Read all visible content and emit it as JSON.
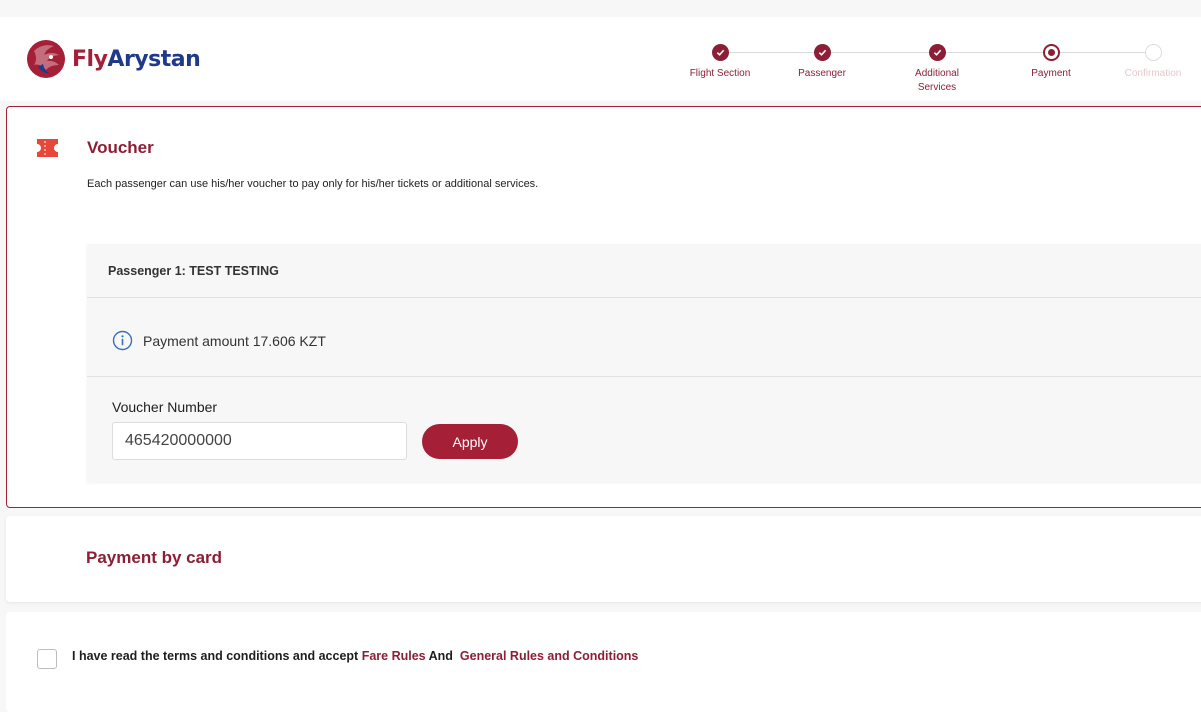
{
  "brand": {
    "name_part1": "Fly",
    "name_part2": "Arystan",
    "colors": {
      "primary": "#a51f37",
      "dark": "#8c1f35",
      "blue": "#1f3a8a"
    }
  },
  "stepper": {
    "steps": [
      {
        "label": "Flight Section",
        "state": "done"
      },
      {
        "label": "Passenger",
        "state": "done"
      },
      {
        "label": "Additional Services",
        "state": "done"
      },
      {
        "label": "Payment",
        "state": "current"
      },
      {
        "label": "Confirmation",
        "state": "todo"
      }
    ]
  },
  "voucher": {
    "icon": "ticket-icon",
    "title": "Voucher",
    "description": "Each passenger can use his/her voucher to pay only for his/her tickets or additional services.",
    "passenger": {
      "name": "Passenger 1: TEST TESTING",
      "payment_icon": "info-icon",
      "payment_amount": "Payment amount 17.606 KZT",
      "voucher_number_label": "Voucher Number",
      "voucher_number_value": "465420000000",
      "apply_label": "Apply"
    }
  },
  "card_payment": {
    "title": "Payment by card"
  },
  "terms": {
    "text": "I have read the terms and conditions and accept",
    "fare_rules_link": "Fare Rules",
    "and_text": "And",
    "general_rules_link": "General Rules and Conditions"
  }
}
